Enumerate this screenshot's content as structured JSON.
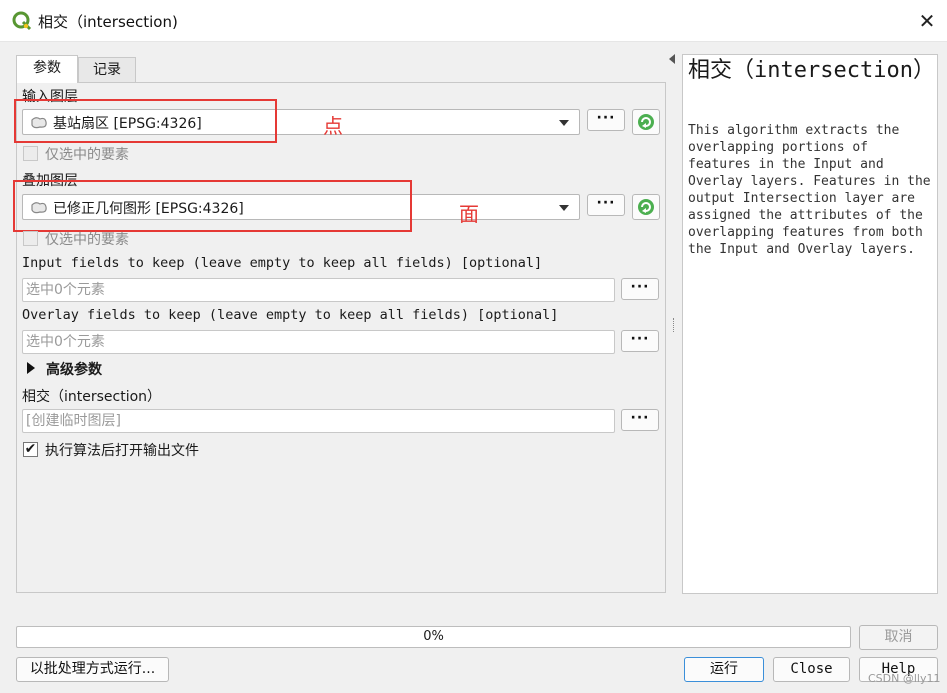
{
  "window": {
    "title": "相交（intersection)",
    "close_glyph": "✕"
  },
  "tabs": [
    {
      "label": "参数"
    },
    {
      "label": "记录"
    }
  ],
  "params": {
    "input_layer": {
      "label": "输入图层",
      "value": "基站扇区 [EPSG:4326]",
      "selected_only_label": "仅选中的要素",
      "annotation": "点"
    },
    "overlay_layer": {
      "label": "叠加图层",
      "value": "已修正几何图形 [EPSG:4326]",
      "selected_only_label": "仅选中的要素",
      "annotation": "面"
    },
    "input_fields": {
      "label": "Input fields to keep (leave empty to keep all fields) [optional]",
      "placeholder": "选中0个元素"
    },
    "overlay_fields": {
      "label": "Overlay fields to keep (leave empty to keep all fields) [optional]",
      "placeholder": "选中0个元素"
    },
    "advanced_label": "高级参数",
    "output": {
      "label": "相交（intersection）",
      "placeholder": "[创建临时图层]"
    },
    "open_output": {
      "label": "执行算法后打开输出文件",
      "checked": true
    },
    "more_glyph": "···"
  },
  "help": {
    "title": "相交（intersection）",
    "body": "This algorithm extracts the overlapping portions of features in the Input and Overlay layers. Features in the output Intersection layer are assigned the attributes of the overlapping features from both the Input and Overlay layers."
  },
  "progress": {
    "text": "0%",
    "value": 0
  },
  "buttons": {
    "cancel": "取消",
    "batch": "以批处理方式运行...",
    "run": "运行",
    "close": "Close",
    "help": "Help"
  },
  "watermark": "CSDN @lly11",
  "colors": {
    "annotation_red": "#e53935",
    "qgis_green": "#589632",
    "qgis_yellow": "#f0c419"
  }
}
